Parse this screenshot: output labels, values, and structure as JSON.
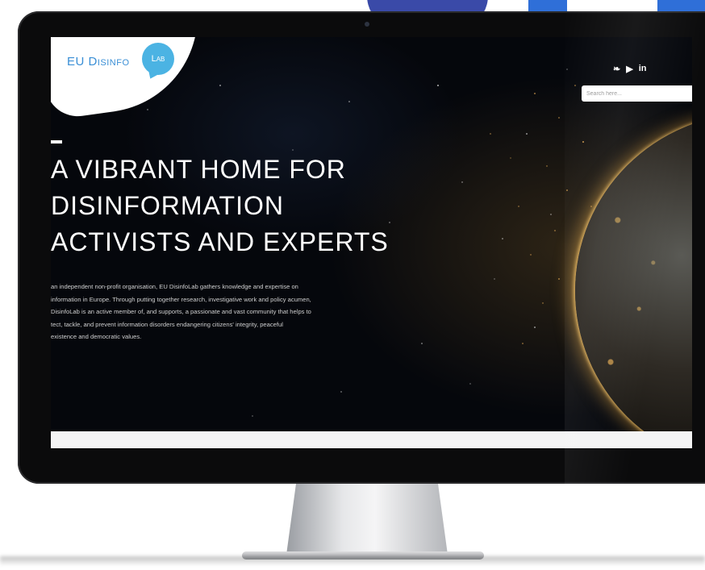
{
  "site": {
    "logo": {
      "text": "EU Disinfo",
      "bubble": "Lab"
    },
    "social": {
      "twitter": "❧",
      "youtube": "▶",
      "linkedin": "in"
    },
    "search": {
      "placeholder": "Search here..."
    },
    "hero": {
      "title_lines": [
        "A VIBRANT HOME FOR",
        "DISINFORMATION",
        "ACTIVISTS AND EXPERTS"
      ],
      "body_lines": [
        "an independent non-profit organisation, EU DisinfoLab gathers knowledge and expertise on",
        "information in Europe. Through putting together research, investigative work and policy acumen,",
        "DisinfoLab is an active member of, and supports, a passionate and vast community that helps to",
        "tect, tackle, and prevent information disorders endangering citizens' integrity, peaceful",
        "existence and democratic values."
      ]
    }
  },
  "colors": {
    "logo_blue": "#3a8fd6",
    "bubble_blue": "#4bb3e3",
    "deco_navy": "#3a4aa8",
    "deco_blue": "#2f6fd8",
    "bezel": "#0b0b0c"
  }
}
